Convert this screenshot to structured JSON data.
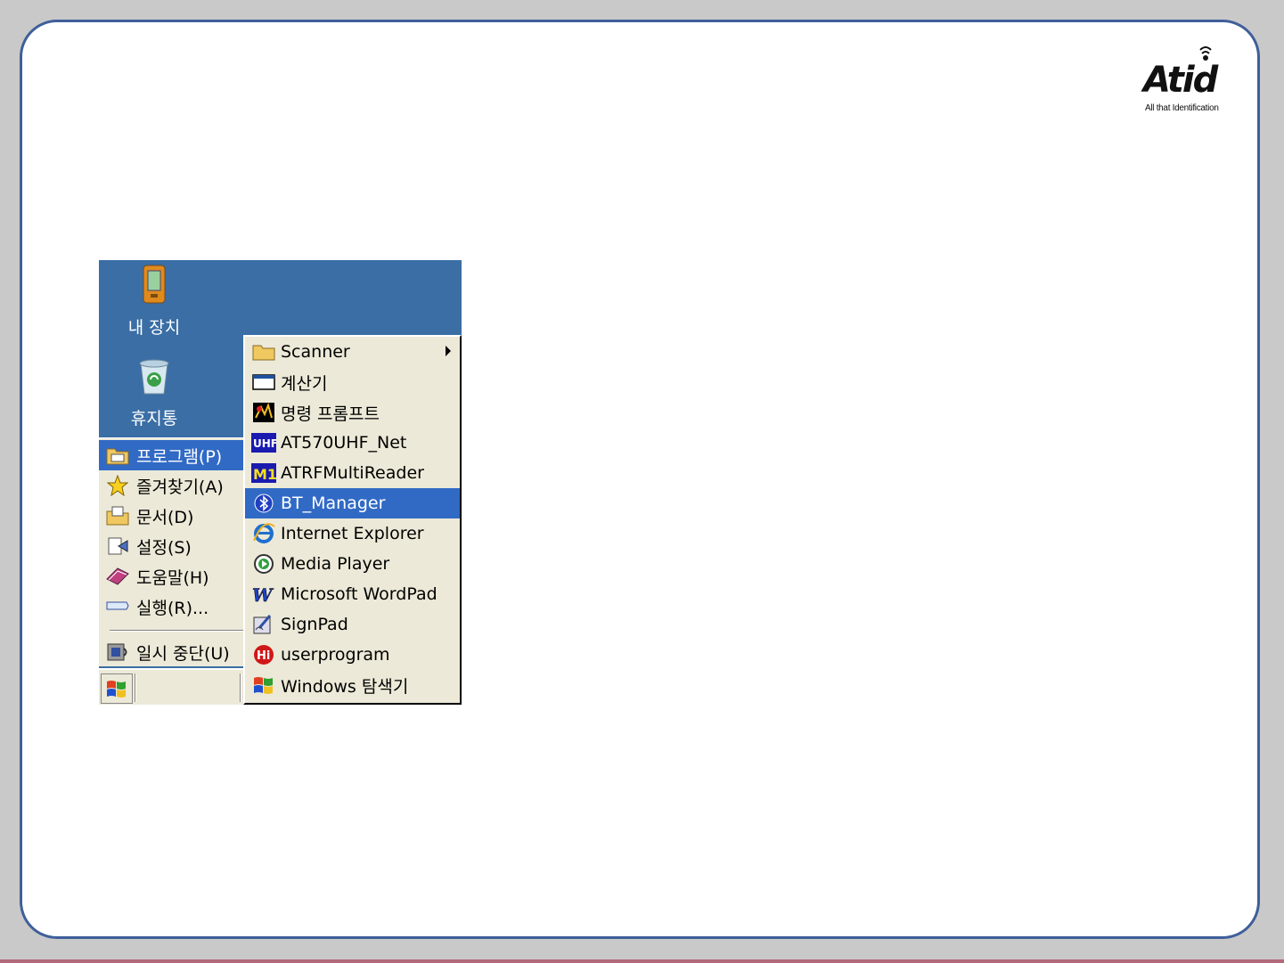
{
  "logo": {
    "name": "Atid",
    "tagline": "All that Identification"
  },
  "desktop": {
    "icons": [
      {
        "label": "내 장치",
        "icon": "device-icon"
      },
      {
        "label": "휴지통",
        "icon": "recycle-bin-icon"
      }
    ]
  },
  "start_menu": {
    "items": [
      {
        "label": "프로그램(P)",
        "icon": "folder-programs-icon",
        "active": true
      },
      {
        "label": "즐겨찾기(A)",
        "icon": "star-icon"
      },
      {
        "label": "문서(D)",
        "icon": "documents-icon"
      },
      {
        "label": "설정(S)",
        "icon": "settings-icon"
      },
      {
        "label": "도움말(H)",
        "icon": "help-book-icon"
      },
      {
        "label": "실행(R)...",
        "icon": "run-icon"
      }
    ],
    "shutdown": {
      "label": "일시 중단(U)",
      "icon": "suspend-icon"
    }
  },
  "programs_menu": {
    "items": [
      {
        "label": "Scanner",
        "icon": "folder-icon",
        "has_submenu": true
      },
      {
        "label": "계산기",
        "icon": "calculator-window-icon"
      },
      {
        "label": "명령 프롬프트",
        "icon": "command-prompt-icon"
      },
      {
        "label": "AT570UHF_Net",
        "icon": "uhf-icon"
      },
      {
        "label": "ATRFMultiReader",
        "icon": "m1-icon"
      },
      {
        "label": "BT_Manager",
        "icon": "bluetooth-icon",
        "active": true
      },
      {
        "label": "Internet Explorer",
        "icon": "internet-explorer-icon"
      },
      {
        "label": "Media Player",
        "icon": "media-player-icon"
      },
      {
        "label": "Microsoft WordPad",
        "icon": "wordpad-icon"
      },
      {
        "label": "SignPad",
        "icon": "signpad-icon"
      },
      {
        "label": "userprogram",
        "icon": "hi-icon"
      },
      {
        "label": "Windows 탐색기",
        "icon": "windows-explorer-icon"
      }
    ]
  },
  "taskbar": {
    "start_icon": "windows-flag-icon"
  },
  "colors": {
    "desktop": "#3a6ea5",
    "highlight": "#316ac5",
    "menu": "#ece9d8",
    "frame": "#3f5f9a"
  }
}
